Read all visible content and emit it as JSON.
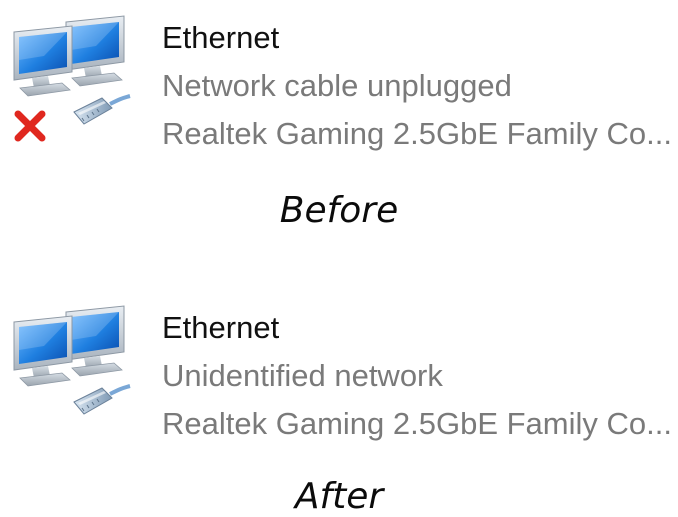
{
  "before": {
    "adapter": {
      "name": "Ethernet",
      "status": "Network cable unplugged",
      "device": "Realtek Gaming 2.5GbE Family Co...",
      "icon": "network-adapter-icon",
      "status_icon": "red-x-icon"
    },
    "caption": "Before"
  },
  "after": {
    "adapter": {
      "name": "Ethernet",
      "status": "Unidentified network",
      "device": "Realtek Gaming 2.5GbE Family Co...",
      "icon": "network-adapter-icon"
    },
    "caption": "After"
  },
  "colors": {
    "name_text": "#111111",
    "secondary_text": "#7a7a7a",
    "error_x": "#e0281f"
  }
}
